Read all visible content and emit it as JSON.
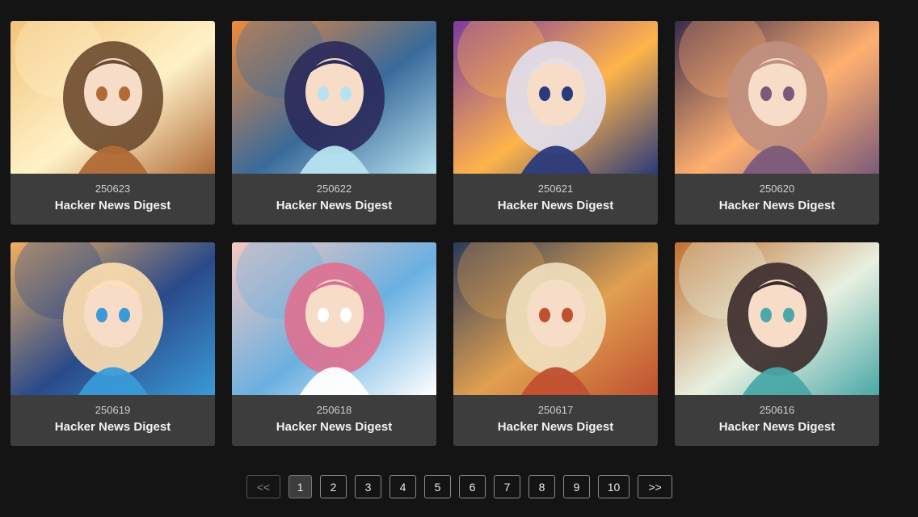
{
  "cards": [
    {
      "date": "250623",
      "title": "Hacker News Digest",
      "palette": [
        "#f2c27a",
        "#fff2c8",
        "#b06a36",
        "#6b4a2e"
      ]
    },
    {
      "date": "250622",
      "title": "Hacker News Digest",
      "palette": [
        "#f08a3a",
        "#3a6a9a",
        "#b7e3f0",
        "#2a2a5a"
      ]
    },
    {
      "date": "250621",
      "title": "Hacker News Digest",
      "palette": [
        "#7a3aa0",
        "#ffb44a",
        "#2a3a7a",
        "#e0e0f0"
      ]
    },
    {
      "date": "250620",
      "title": "Hacker News Digest",
      "palette": [
        "#3a2a4a",
        "#ffb070",
        "#7a5a7a",
        "#c09080"
      ]
    },
    {
      "date": "250619",
      "title": "Hacker News Digest",
      "palette": [
        "#f0b060",
        "#2a4a8a",
        "#3a9ad8",
        "#ffe0b0"
      ]
    },
    {
      "date": "250618",
      "title": "Hacker News Digest",
      "palette": [
        "#f8c8c0",
        "#6ab0e0",
        "#ffffff",
        "#e07090"
      ]
    },
    {
      "date": "250617",
      "title": "Hacker News Digest",
      "palette": [
        "#2a3a5a",
        "#e0a050",
        "#c05030",
        "#f0e0c0"
      ]
    },
    {
      "date": "250616",
      "title": "Hacker News Digest",
      "palette": [
        "#c07030",
        "#e8f0e0",
        "#4aa8a8",
        "#3a2a2a"
      ]
    }
  ],
  "pagination": {
    "prev_label": "<<",
    "next_label": ">>",
    "pages": [
      "1",
      "2",
      "3",
      "4",
      "5",
      "6",
      "7",
      "8",
      "9",
      "10"
    ],
    "current": "1"
  }
}
